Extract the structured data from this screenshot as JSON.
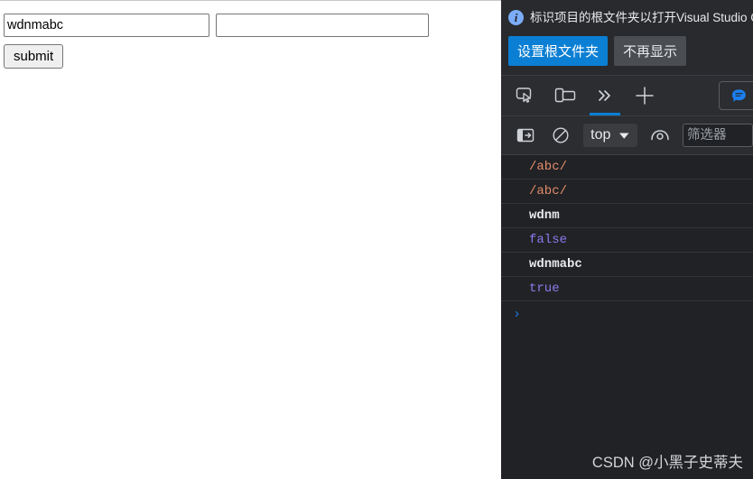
{
  "page": {
    "input_one": {
      "value": "wdnmabc",
      "placeholder": ""
    },
    "input_two": {
      "value": "",
      "placeholder": ""
    },
    "submit_label": "submit"
  },
  "devtools": {
    "notification": {
      "icon": "info-icon",
      "message": "标识项目的根文件夹以打开Visual Studio Code中的源文件并同步更",
      "primary_button": "设置根文件夹",
      "secondary_button": "不再显示"
    },
    "toolbar": {
      "inspect_icon": "inspect-element-icon",
      "device_toggle_icon": "device-toolbar-icon",
      "more_tabs_icon": "more-tabs-chevrons-icon",
      "new_tab_icon": "plus-icon",
      "chat_icon": "ai-chat-bubble-icon",
      "active_tab": "more-tabs"
    },
    "console_toolbar": {
      "sidebar_icon": "console-sidebar-icon",
      "clear_icon": "clear-console-icon",
      "context_value": "top",
      "context_chevron": "chevron-down-icon",
      "eye_icon": "live-expression-eye-icon",
      "filter_placeholder": "筛选器",
      "filter_value": ""
    },
    "console_rows": [
      {
        "text": "/abc/",
        "kind": "regex"
      },
      {
        "text": "/abc/",
        "kind": "regex"
      },
      {
        "text": "wdnm",
        "kind": "string"
      },
      {
        "text": "false",
        "kind": "boolean"
      },
      {
        "text": "wdnmabc",
        "kind": "string"
      },
      {
        "text": "true",
        "kind": "boolean"
      }
    ],
    "console_prompt_symbol": "›",
    "watermark": "CSDN @小黑子史蒂夫"
  },
  "colors": {
    "accent_blue": "#0b7fd4",
    "console_bg": "#212225",
    "toolbar_bg": "#2b2d31",
    "regex_orange": "#e38c6b",
    "boolean_purple": "#8a7bf0",
    "text_light": "#e8eaed"
  }
}
